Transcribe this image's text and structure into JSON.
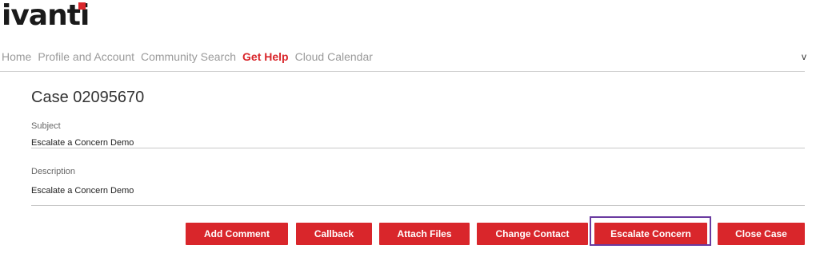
{
  "logo": {
    "text": "ivanti",
    "mark_color": "#d9262b"
  },
  "nav": {
    "items": [
      {
        "label": "Home",
        "active": false
      },
      {
        "label": "Profile and Account",
        "active": false
      },
      {
        "label": "Community Search",
        "active": false
      },
      {
        "label": "Get Help",
        "active": true
      },
      {
        "label": "Cloud Calendar",
        "active": false
      }
    ],
    "edge_glyph": "v"
  },
  "case": {
    "title": "Case 02095670",
    "subject_label": "Subject",
    "subject_value": "Escalate a Concern Demo",
    "description_label": "Description",
    "description_value": "Escalate a Concern Demo"
  },
  "actions": {
    "add_comment": "Add Comment",
    "callback": "Callback",
    "attach_files": "Attach Files",
    "change_contact": "Change Contact",
    "escalate_concern": "Escalate Concern",
    "close_case": "Close Case"
  },
  "colors": {
    "accent": "#d9262b",
    "highlight_box": "#6a3aa0",
    "nav_inactive": "#9a9a9a"
  }
}
